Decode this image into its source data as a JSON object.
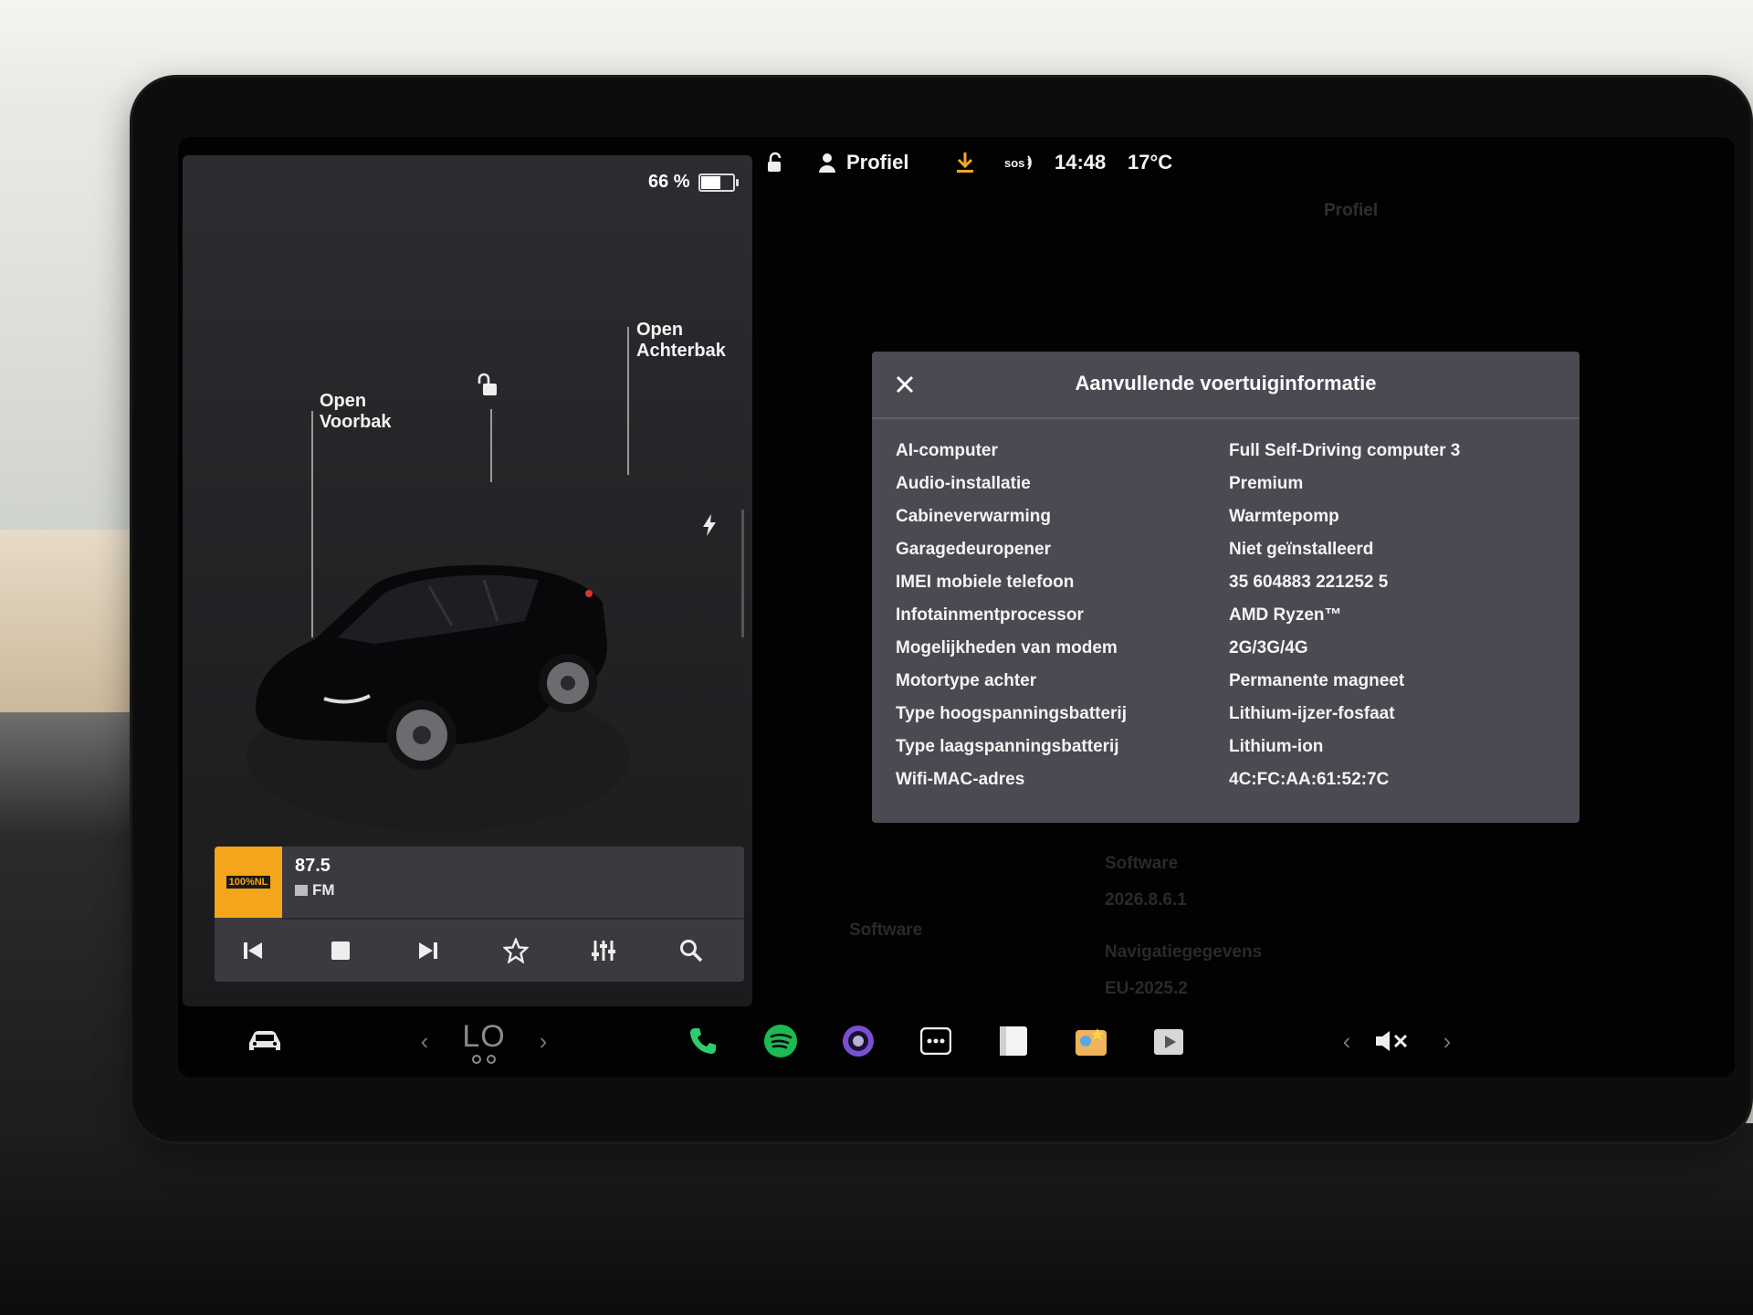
{
  "status_bar": {
    "battery_percent_label": "66 %",
    "battery_level": 0.66,
    "profile_label": "Profiel",
    "sos_label": "sos",
    "time": "14:48",
    "temperature": "17°C"
  },
  "car_panel": {
    "frunk_label_line1": "Open",
    "frunk_label_line2": "Voorbak",
    "trunk_label_line1": "Open",
    "trunk_label_line2": "Achterbak"
  },
  "media": {
    "station_logo_text": "100%NL",
    "frequency": "87.5",
    "band": "FM",
    "controls": [
      "previous-icon",
      "stop-icon",
      "next-icon",
      "favorite-icon",
      "equalizer-icon",
      "search-icon"
    ]
  },
  "background_settings": {
    "profile_label": "Profiel",
    "software_heading": "Software",
    "software_version": "2026.8.6.1",
    "nav_heading": "Navigatiegegevens",
    "nav_version": "EU-2025.2",
    "menu_software": "Software"
  },
  "dialog": {
    "title": "Aanvullende voertuiginformatie",
    "rows": [
      {
        "label": "AI-computer",
        "value": "Full Self-Driving computer 3"
      },
      {
        "label": "Audio-installatie",
        "value": "Premium"
      },
      {
        "label": "Cabineverwarming",
        "value": "Warmtepomp"
      },
      {
        "label": "Garagedeuropener",
        "value": "Niet geïnstalleerd"
      },
      {
        "label": "IMEI mobiele telefoon",
        "value": "35 604883 221252 5"
      },
      {
        "label": "Infotainmentprocessor",
        "value": "AMD Ryzen™"
      },
      {
        "label": "Mogelijkheden van modem",
        "value": "2G/3G/4G"
      },
      {
        "label": "Motortype achter",
        "value": "Permanente magneet"
      },
      {
        "label": "Type hoogspanningsbatterij",
        "value": "Lithium-ijzer-fosfaat"
      },
      {
        "label": "Type laagspanningsbatterij",
        "value": "Lithium-ion"
      },
      {
        "label": "Wifi-MAC-adres",
        "value": "4C:FC:AA:61:52:7C"
      }
    ]
  },
  "dock": {
    "climate_temp": "LO",
    "colors": {
      "phone": "#2ecc71",
      "spotify": "#1db954",
      "camera": "#7b4fd1"
    }
  }
}
